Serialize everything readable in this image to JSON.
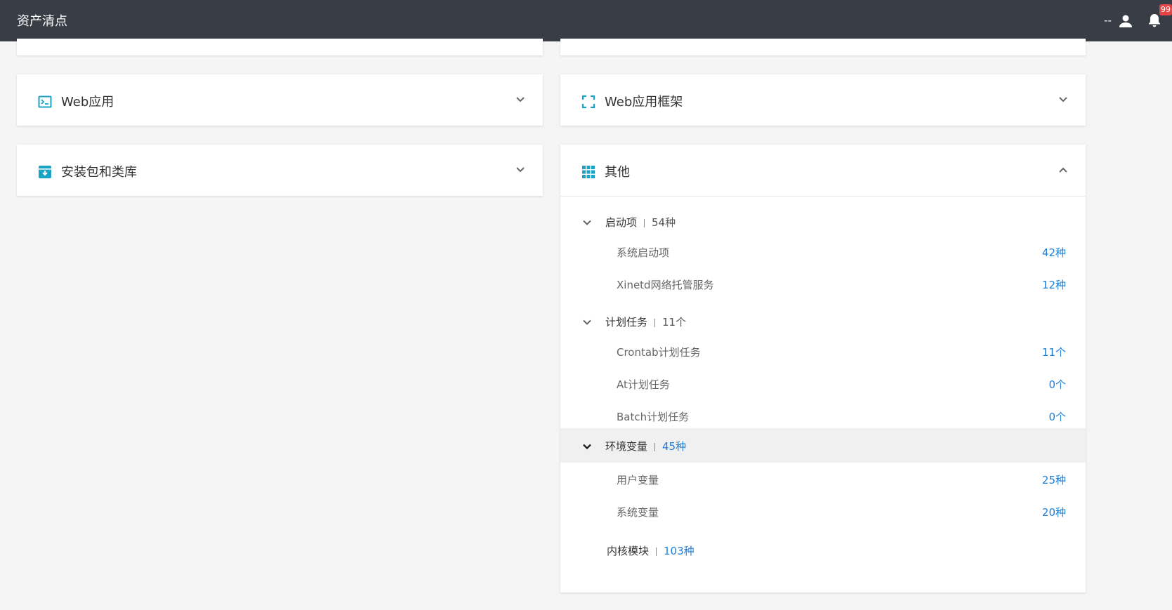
{
  "topbar": {
    "title": "资产清点",
    "username": "--",
    "badge": "99"
  },
  "cards": {
    "web_app": {
      "title": "Web应用"
    },
    "web_framework": {
      "title": "Web应用框架"
    },
    "packages": {
      "title": "安装包和类库"
    },
    "other": {
      "title": "其他"
    }
  },
  "other": {
    "startup": {
      "label": "启动项",
      "count": "54种",
      "items": [
        {
          "label": "系统启动项",
          "value": "42种"
        },
        {
          "label": "Xinetd网络托管服务",
          "value": "12种"
        }
      ]
    },
    "tasks": {
      "label": "计划任务",
      "count": "11个",
      "items": [
        {
          "label": "Crontab计划任务",
          "value": "11个"
        },
        {
          "label": "At计划任务",
          "value": "0个"
        },
        {
          "label": "Batch计划任务",
          "value": "0个"
        }
      ]
    },
    "env": {
      "label": "环境变量",
      "count": "45种",
      "items": [
        {
          "label": "用户变量",
          "value": "25种"
        },
        {
          "label": "系统变量",
          "value": "20种"
        }
      ]
    },
    "kernel": {
      "label": "内核模块",
      "count": "103种"
    }
  },
  "colors": {
    "topbar": "#393e46",
    "accent": "#1e7ed6",
    "icon": "#1aa3c4",
    "badge": "#e54545"
  }
}
